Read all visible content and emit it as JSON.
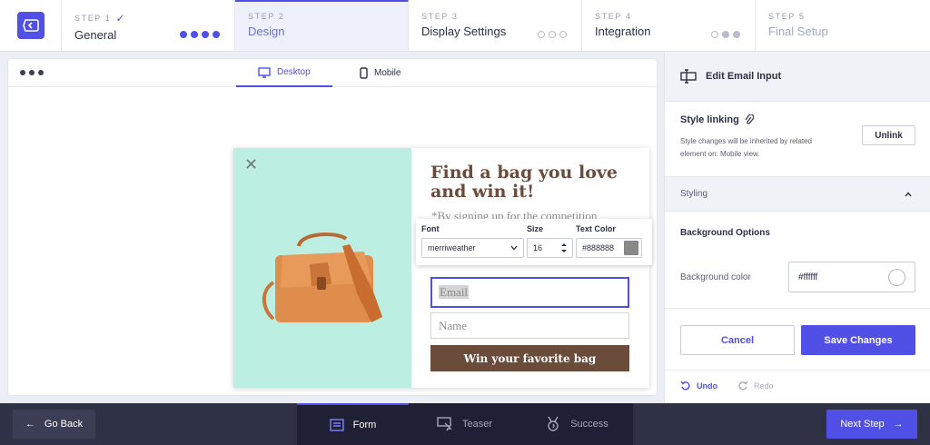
{
  "steps": [
    {
      "num": "STEP 1",
      "title": "General",
      "check": "✓"
    },
    {
      "num": "STEP 2",
      "title": "Design"
    },
    {
      "num": "STEP 3",
      "title": "Display Settings"
    },
    {
      "num": "STEP 4",
      "title": "Integration"
    },
    {
      "num": "STEP 5",
      "title": "Final Setup"
    }
  ],
  "canvas": {
    "tabs": {
      "desktop": "Desktop",
      "mobile": "Mobile"
    }
  },
  "popup": {
    "close": "✕",
    "headline": "Find a bag you love and win it!",
    "subtext": "*By signing up for the competition",
    "email_placeholder": "Email",
    "name_placeholder": "Name",
    "button": "Win your favorite bag"
  },
  "font_toolbar": {
    "font_label": "Font",
    "size_label": "Size",
    "color_label": "Text Color",
    "font_value": "merriweather",
    "size_value": "16",
    "color_value": "#888888",
    "swatch_color": "#888888"
  },
  "right_panel": {
    "title": "Edit Email Input",
    "style_linking": {
      "title": "Style linking",
      "desc": "Style changes will be inherited by related element on: Mobile view.",
      "unlink": "Unlink"
    },
    "styling_label": "Styling",
    "background": {
      "title": "Background Options",
      "label": "Background color",
      "value": "#ffffff"
    },
    "cancel": "Cancel",
    "save": "Save Changes",
    "undo": "Undo",
    "redo": "Redo"
  },
  "bottom": {
    "go_back": "Go Back",
    "tabs": {
      "form": "Form",
      "teaser": "Teaser",
      "success": "Success"
    },
    "next": "Next Step"
  },
  "colors": {
    "accent": "#5050e6",
    "popup_bg": "#bdeee2",
    "brand_brown": "#6b4c3b",
    "bottom_bar": "#2f3145"
  }
}
